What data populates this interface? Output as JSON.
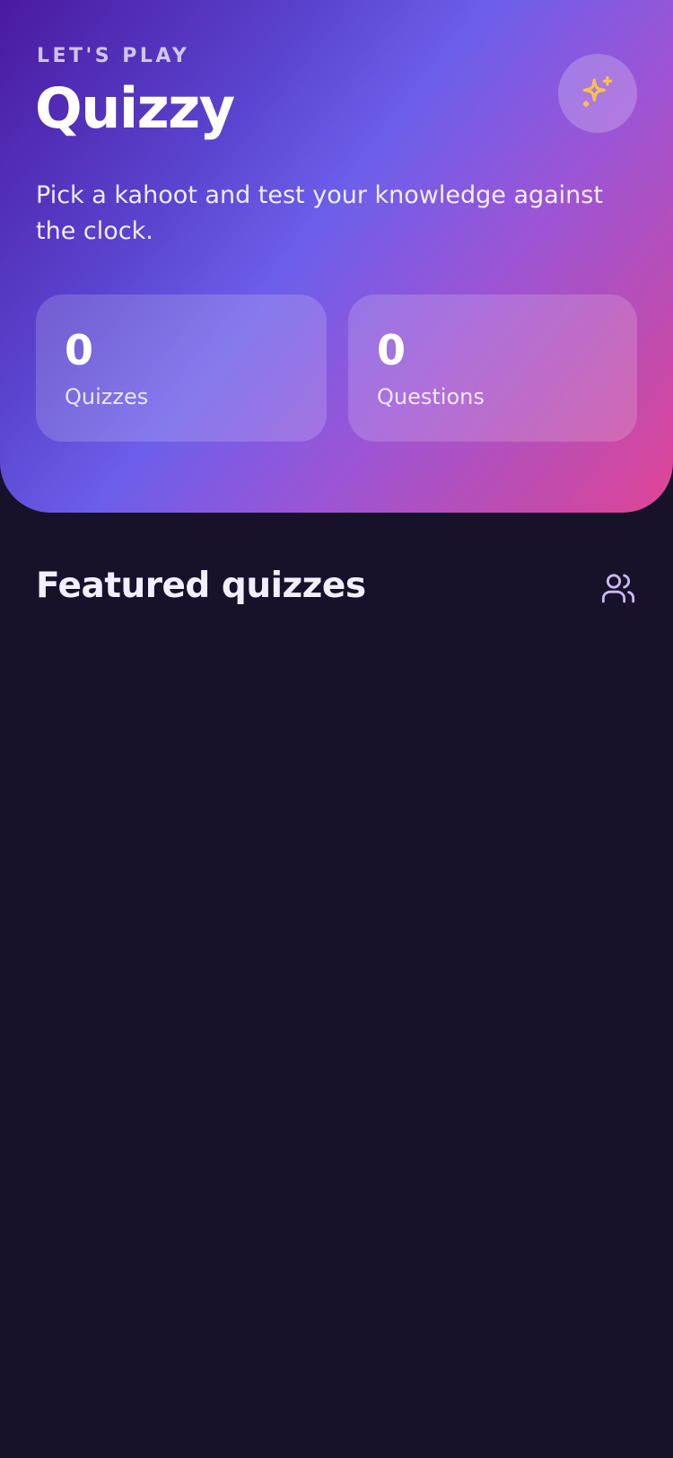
{
  "header": {
    "eyebrow": "LET'S PLAY",
    "title": "Quizzy",
    "subtitle": "Pick a kahoot and test your knowledge against the clock.",
    "action_icon": "sparkles-icon"
  },
  "stats": [
    {
      "value": "0",
      "label": "Quizzes"
    },
    {
      "value": "0",
      "label": "Questions"
    }
  ],
  "featured": {
    "title": "Featured quizzes",
    "action_icon": "users-icon"
  },
  "colors": {
    "background": "#17112a",
    "gradient_start": "#4a1aa0",
    "gradient_mid": "#6c5fea",
    "gradient_end": "#e14496",
    "sparkle": "#f6c14f",
    "people_icon": "#c9b8f2"
  }
}
